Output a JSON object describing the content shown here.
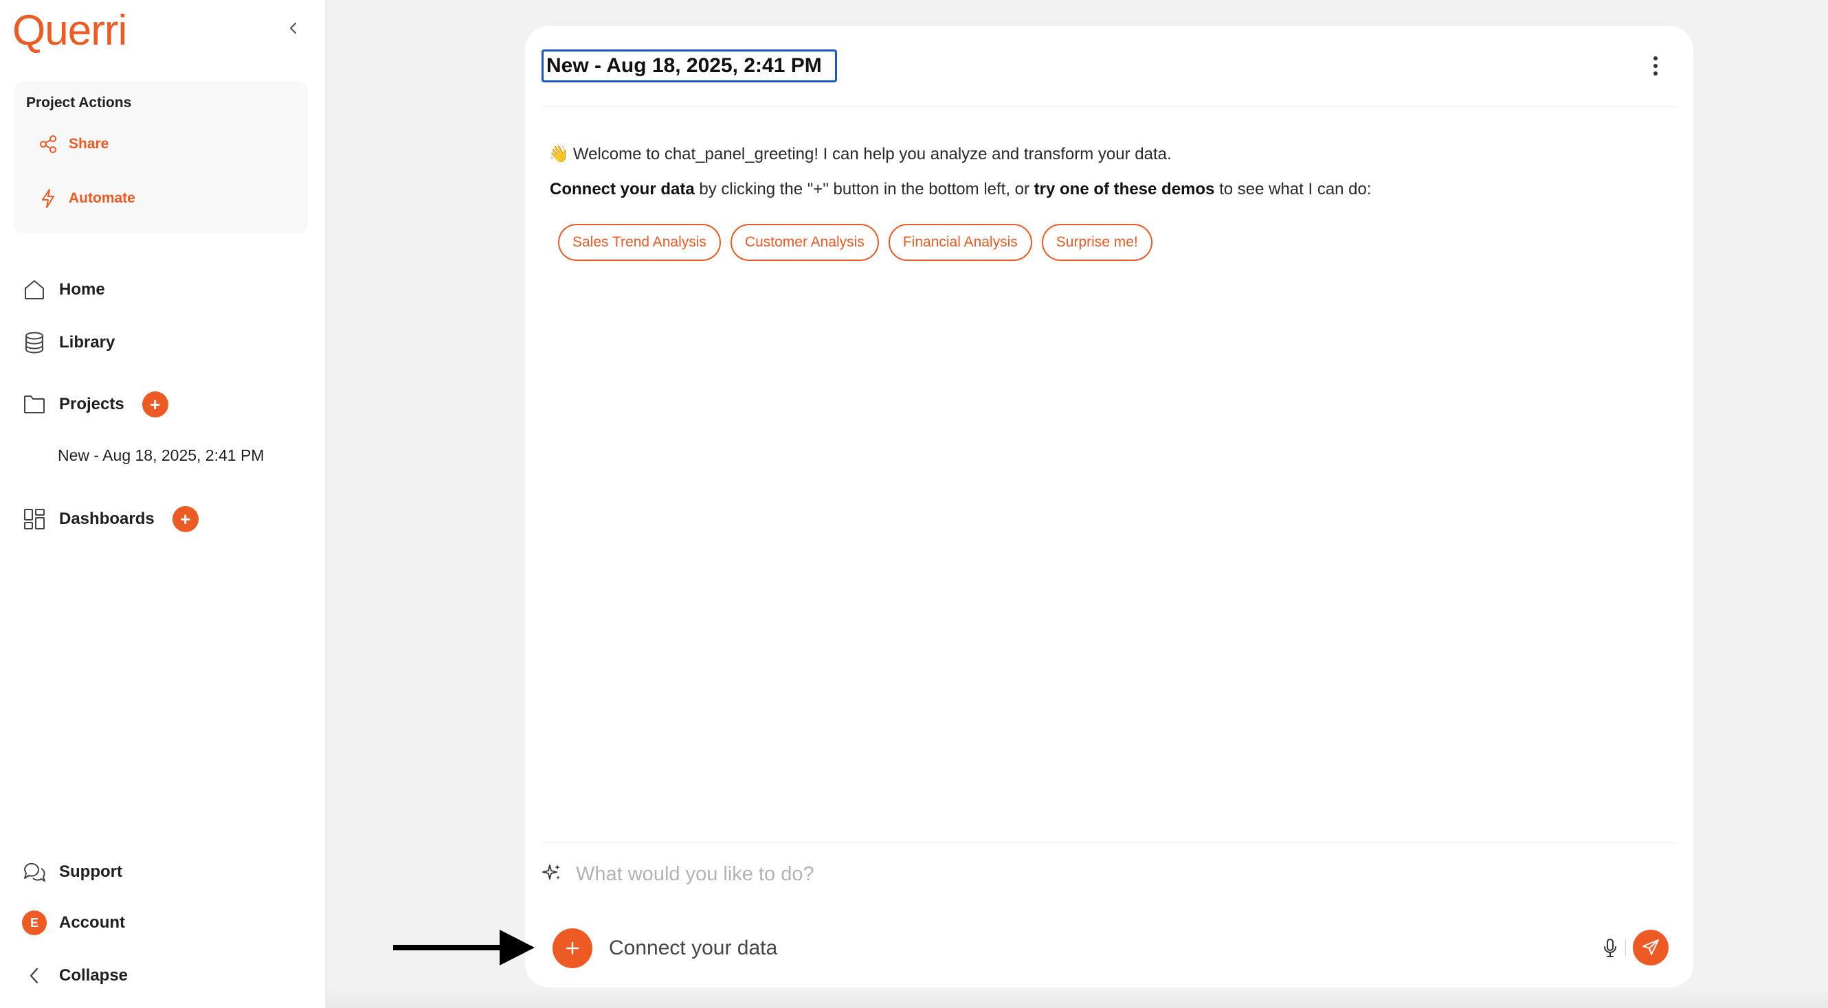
{
  "sidebar": {
    "logo": "Querri",
    "project_actions": {
      "title": "Project Actions",
      "share": "Share",
      "automate": "Automate"
    },
    "nav": {
      "home": "Home",
      "library": "Library",
      "projects": "Projects",
      "project_item": "New - Aug 18, 2025, 2:41 PM",
      "dashboards": "Dashboards"
    },
    "bottom": {
      "support": "Support",
      "account": "Account",
      "account_initial": "E",
      "collapse": "Collapse"
    },
    "add_symbol": "+"
  },
  "panel": {
    "title": "New - Aug 18, 2025, 2:41 PM",
    "greeting_emoji": "👋",
    "greeting": "Welcome to chat_panel_greeting! I can help you analyze and transform your data.",
    "connect": {
      "bold1": "Connect your data",
      "text1": " by clicking the \"+\" button in the bottom left, or ",
      "bold2": "try one of these demos",
      "text2": " to see what I can do:"
    },
    "chips": [
      "Sales Trend Analysis",
      "Customer Analysis",
      "Financial Analysis",
      "Surprise me!"
    ],
    "prompt_placeholder": "What would you like to do?",
    "connect_data_label": "Connect your data"
  },
  "colors": {
    "accent": "#ee5a24",
    "title_border": "#1a57b8"
  },
  "icons": {
    "collapse": "chevron-left-icon",
    "share": "share-icon",
    "automate": "lightning-icon",
    "home": "home-icon",
    "library": "database-icon",
    "projects": "folder-icon",
    "dashboards": "dashboard-icon",
    "support": "chat-bubbles-icon",
    "sparkle": "sparkle-icon",
    "plus": "plus-icon",
    "mic": "microphone-icon",
    "send": "send-icon",
    "menu": "kebab-menu-icon"
  }
}
